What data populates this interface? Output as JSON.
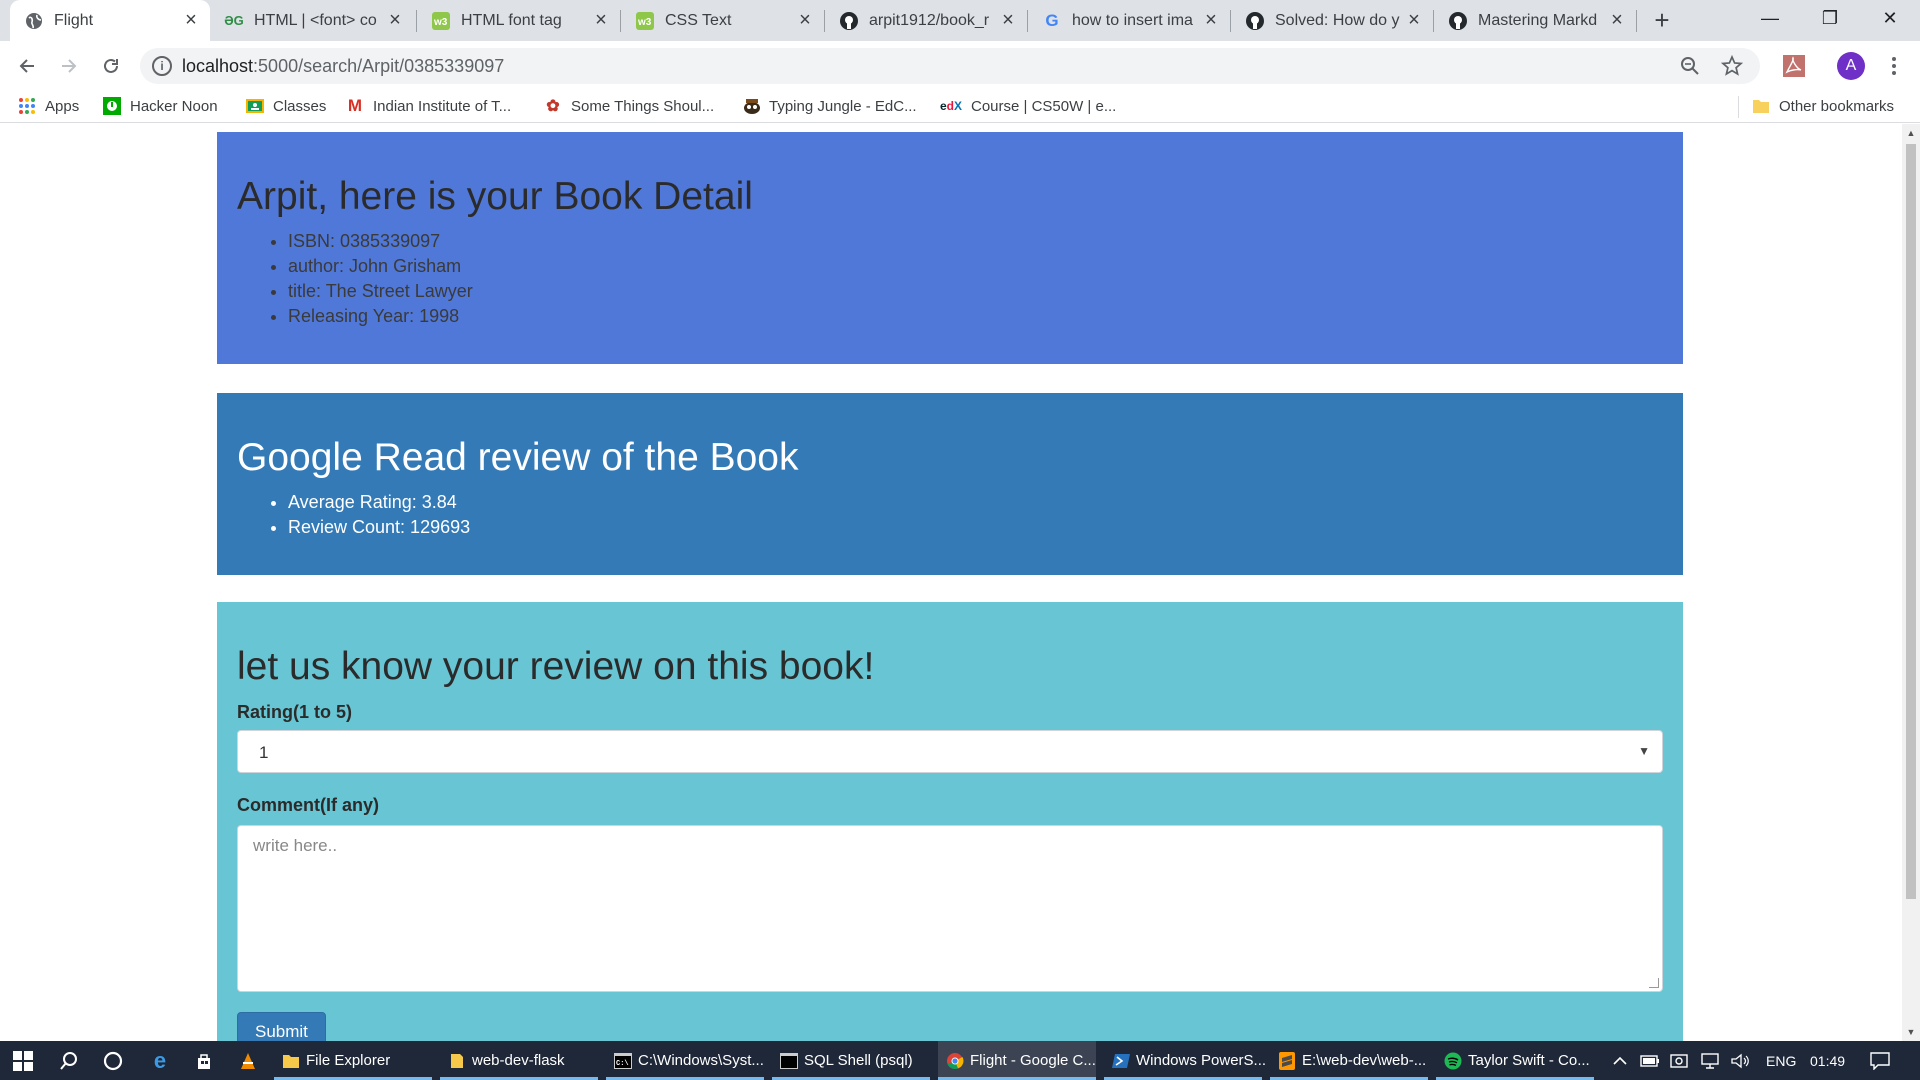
{
  "browser": {
    "tabs": [
      {
        "title": "Flight",
        "icon": "globe-icon",
        "active": true
      },
      {
        "title": "HTML | <font> co",
        "icon": "geeksforgeeks-icon",
        "active": false
      },
      {
        "title": "HTML font tag",
        "icon": "w3schools-icon",
        "active": false
      },
      {
        "title": "CSS Text",
        "icon": "w3schools-icon",
        "active": false
      },
      {
        "title": "arpit1912/book_r",
        "icon": "github-icon",
        "active": false
      },
      {
        "title": "how to insert ima",
        "icon": "google-icon",
        "active": false
      },
      {
        "title": "Solved: How do y",
        "icon": "github-icon",
        "active": false
      },
      {
        "title": "Mastering Markd",
        "icon": "github-icon",
        "active": false
      }
    ],
    "new_tab_glyph": "+",
    "window_controls": {
      "minimize": "—",
      "restore": "❐",
      "close": "✕"
    },
    "url_host": "localhost",
    "url_path": ":5000/search/Arpit/0385339097",
    "avatar_letter": "A",
    "bookmarks": [
      {
        "label": "Apps",
        "icon": "apps-grid-icon"
      },
      {
        "label": "Hacker Noon",
        "icon": "hacker-noon-icon"
      },
      {
        "label": "Classes",
        "icon": "google-classroom-icon"
      },
      {
        "label": "Indian Institute of T...",
        "icon": "gmail-icon"
      },
      {
        "label": "Some Things Shoul...",
        "icon": "bookmark-logo-icon"
      },
      {
        "label": "Typing Jungle - EdC...",
        "icon": "typing-jungle-icon"
      },
      {
        "label": "Course | CS50W | e...",
        "icon": "edx-icon"
      }
    ],
    "other_bookmarks": "Other bookmarks"
  },
  "page": {
    "detail": {
      "heading": "Arpit, here is your Book Detail",
      "items": [
        "ISBN: 0385339097",
        "author: John Grisham",
        "title: The Street Lawyer",
        "Releasing Year: 1998"
      ]
    },
    "google_review": {
      "heading": "Google Read review of the Book",
      "items": [
        "Average Rating: 3.84",
        "Review Count: 129693"
      ]
    },
    "review_form": {
      "heading": "let us know your review on this book!",
      "rating_label": "Rating(1 to 5)",
      "rating_value": "1",
      "comment_label": "Comment(If any)",
      "comment_placeholder": "write here..",
      "submit_label": "Submit"
    },
    "colors": {
      "detail_bg": "#5078d8",
      "review_bg": "#337ab7",
      "form_bg": "#67c5d4"
    }
  },
  "taskbar": {
    "apps": [
      {
        "label": "File Explorer",
        "icon": "folder-icon",
        "active": false
      },
      {
        "label": "web-dev-flask",
        "icon": "folder-icon",
        "active": false
      },
      {
        "label": "C:\\Windows\\Syst...",
        "icon": "cmd-icon",
        "active": false
      },
      {
        "label": "SQL Shell (psql)",
        "icon": "terminal-icon",
        "active": false
      },
      {
        "label": "Flight - Google C...",
        "icon": "chrome-icon",
        "active": true
      },
      {
        "label": "Windows PowerS...",
        "icon": "powershell-icon",
        "active": false
      },
      {
        "label": "E:\\web-dev\\web-...",
        "icon": "sublime-icon",
        "active": false
      },
      {
        "label": "Taylor Swift - Co...",
        "icon": "spotify-icon",
        "active": false
      }
    ],
    "language": "ENG",
    "time": "01:49"
  }
}
